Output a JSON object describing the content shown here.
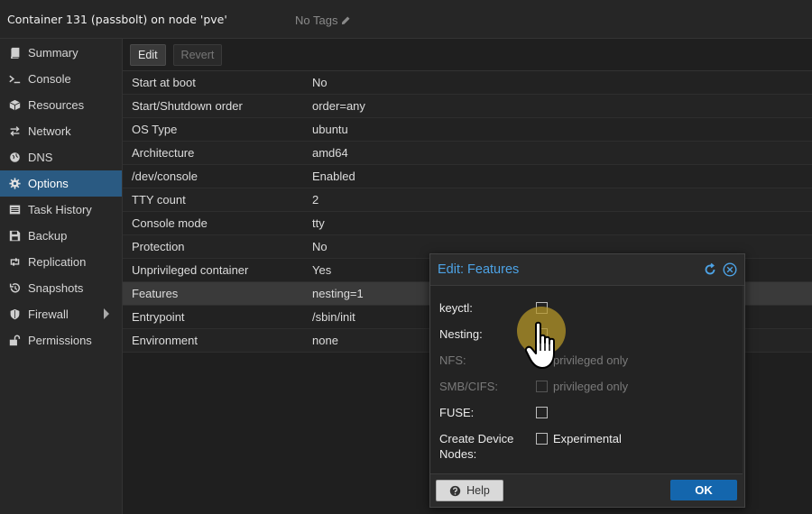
{
  "header": {
    "title": "Container 131 (passbolt) on node 'pve'",
    "tags": "No Tags",
    "tags_icon": "pencil-icon"
  },
  "sidebar": {
    "items": [
      {
        "label": "Summary",
        "icon": "book-icon"
      },
      {
        "label": "Console",
        "icon": "terminal-icon"
      },
      {
        "label": "Resources",
        "icon": "cube-icon"
      },
      {
        "label": "Network",
        "icon": "exchange-icon"
      },
      {
        "label": "DNS",
        "icon": "globe-icon"
      },
      {
        "label": "Options",
        "icon": "gear-icon",
        "active": true
      },
      {
        "label": "Task History",
        "icon": "list-icon"
      },
      {
        "label": "Backup",
        "icon": "floppy-icon"
      },
      {
        "label": "Replication",
        "icon": "retweet-icon"
      },
      {
        "label": "Snapshots",
        "icon": "history-icon"
      },
      {
        "label": "Firewall",
        "icon": "shield-icon",
        "expandable": true
      },
      {
        "label": "Permissions",
        "icon": "unlock-icon"
      }
    ]
  },
  "toolbar": {
    "edit_label": "Edit",
    "revert_label": "Revert"
  },
  "options": [
    {
      "key": "Start at boot",
      "value": "No"
    },
    {
      "key": "Start/Shutdown order",
      "value": "order=any"
    },
    {
      "key": "OS Type",
      "value": "ubuntu"
    },
    {
      "key": "Architecture",
      "value": "amd64"
    },
    {
      "key": "/dev/console",
      "value": "Enabled"
    },
    {
      "key": "TTY count",
      "value": "2"
    },
    {
      "key": "Console mode",
      "value": "tty"
    },
    {
      "key": "Protection",
      "value": "No"
    },
    {
      "key": "Unprivileged container",
      "value": "Yes"
    },
    {
      "key": "Features",
      "value": "nesting=1",
      "selected": true
    },
    {
      "key": "Entrypoint",
      "value": "/sbin/init"
    },
    {
      "key": "Environment",
      "value": "none"
    }
  ],
  "dialog": {
    "title": "Edit: Features",
    "fields": {
      "keyctl": {
        "label": "keyctl:",
        "checked": false
      },
      "nesting": {
        "label": "Nesting:",
        "checked": true
      },
      "nfs": {
        "label": "NFS:",
        "after": "privileged only",
        "disabled": true
      },
      "smb": {
        "label": "SMB/CIFS:",
        "after": "privileged only",
        "disabled": true
      },
      "fuse": {
        "label": "FUSE:",
        "checked": false
      },
      "mknod": {
        "label": "Create Device Nodes:",
        "after": "Experimental"
      }
    },
    "help_label": "Help",
    "ok_label": "OK"
  },
  "colors": {
    "accent": "#1466ad",
    "active_nav": "#2a5a82",
    "dialog_title": "#4da3e6",
    "highlight": "#b4962a"
  }
}
